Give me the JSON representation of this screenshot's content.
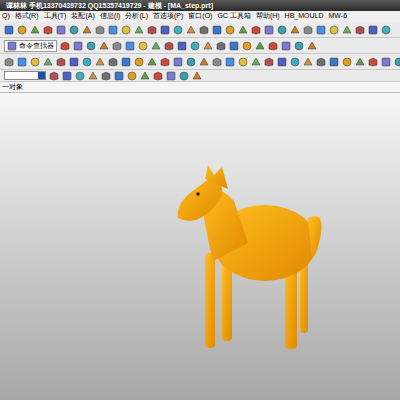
{
  "window": {
    "title": "谭林林 手机13370439732 QQ15357419729 - 建模 - [MA_step.prt]"
  },
  "menu": [
    "Q)",
    "格式(R)",
    "工具(T)",
    "装配(A)",
    "信息(I)",
    "分析(L)",
    "首选项(P)",
    "窗口(O)",
    "GC 工具箱",
    "帮助(H)",
    "HB_MOULD",
    "MW-6"
  ],
  "toolbar": {
    "command_finder": "命令查找器"
  },
  "status": {
    "prompt": "一对象"
  },
  "model": {
    "name": "horse"
  }
}
